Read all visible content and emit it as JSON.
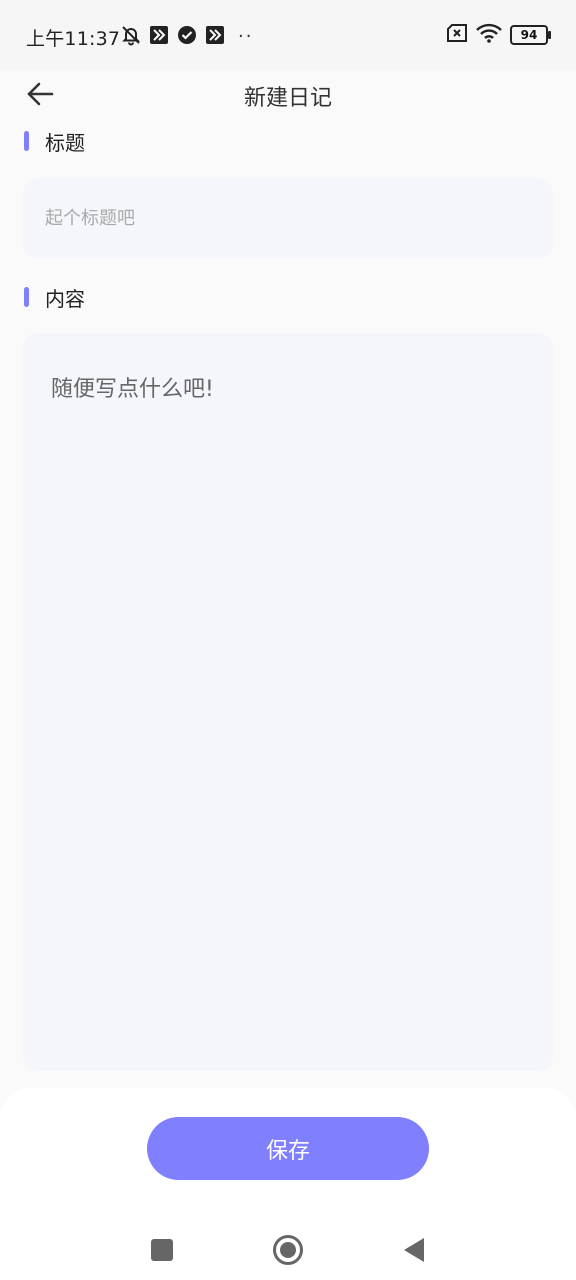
{
  "status_bar": {
    "time": "上午11:37",
    "dots": "··",
    "battery": "94"
  },
  "header": {
    "title": "新建日记"
  },
  "form": {
    "title_label": "标题",
    "title_placeholder": "起个标题吧",
    "content_label": "内容",
    "content_placeholder": "随便写点什么吧!"
  },
  "actions": {
    "save_label": "保存"
  },
  "colors": {
    "accent": "#8080ff",
    "input_bg": "#f4f6fb",
    "page_bg": "#fafafa"
  },
  "icons": {
    "back": "arrow-left-icon",
    "mute": "bell-off-icon",
    "app1": "app-badge-icon",
    "check": "check-circle-icon",
    "sim": "sim-off-icon",
    "wifi": "wifi-icon",
    "battery": "battery-icon",
    "nav_square": "recent-apps-icon",
    "nav_home": "home-icon",
    "nav_back": "nav-back-icon"
  }
}
